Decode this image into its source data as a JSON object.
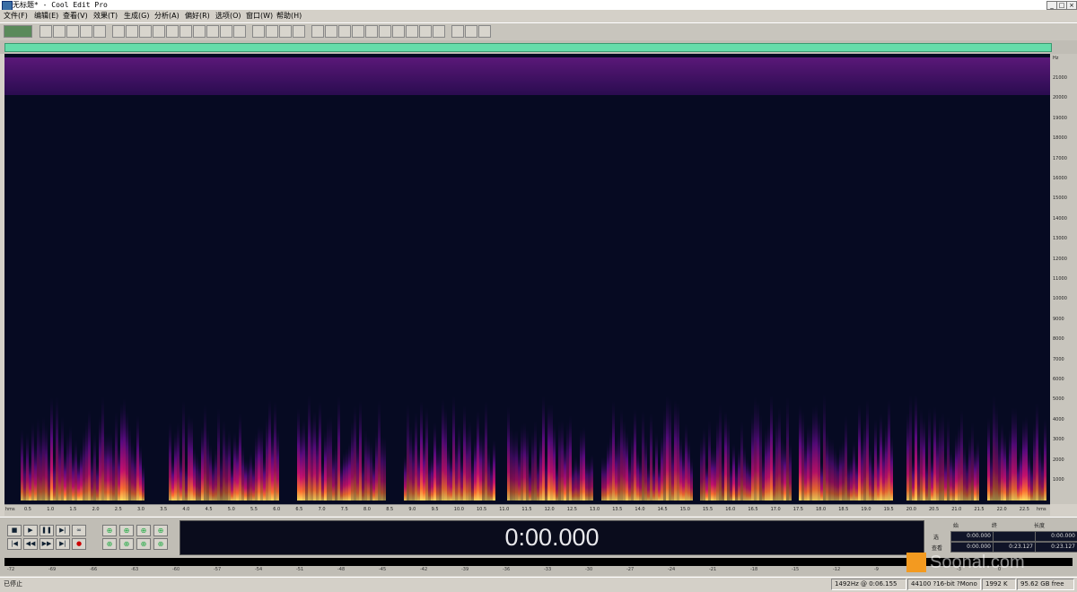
{
  "window": {
    "title": "无标题* - Cool Edit Pro",
    "controls": [
      "_",
      "□",
      "×"
    ]
  },
  "menu": [
    "文件(F)",
    "编辑(E)",
    "查看(V)",
    "效果(T)",
    "生成(G)",
    "分析(A)",
    "偏好(R)",
    "选项(O)",
    "窗口(W)",
    "帮助(H)"
  ],
  "toolbar": {
    "groups": [
      [
        "waveform-view"
      ],
      [
        "new-file-icon",
        "open-file-icon",
        "save-icon",
        "save-as-icon",
        "close-icon"
      ],
      [
        "undo-icon",
        "redo-icon",
        "repeat-icon",
        "copy-icon",
        "paste-icon",
        "cut-icon",
        "mix-paste-icon",
        "crop-icon",
        "trim-icon",
        "select-all-icon"
      ],
      [
        "spectral-view-icon",
        "info-icon",
        "options-icon",
        "settings-icon"
      ],
      [
        "view-1-icon",
        "view-2-icon",
        "view-3-icon",
        "play-icon",
        "view-5-icon",
        "view-6-icon",
        "view-7-icon",
        "view-8-icon",
        "view-9-icon",
        "view-10-icon"
      ],
      [
        "script-icon",
        "batch-icon",
        "help-icon"
      ]
    ]
  },
  "spectrogram": {
    "frequency_unit": "Hz",
    "frequency_ticks": [
      "21000",
      "20000",
      "19000",
      "18000",
      "17000",
      "16000",
      "15000",
      "14000",
      "13000",
      "12000",
      "11000",
      "10000",
      "9000",
      "8000",
      "7000",
      "6000",
      "5000",
      "4000",
      "3000",
      "2000",
      "1000"
    ],
    "time_unit": "hms",
    "time_ticks": [
      "0.5",
      "1.0",
      "1.5",
      "2.0",
      "2.5",
      "3.0",
      "3.5",
      "4.0",
      "4.5",
      "5.0",
      "5.5",
      "6.0",
      "6.5",
      "7.0",
      "7.5",
      "8.0",
      "8.5",
      "9.0",
      "9.5",
      "10.0",
      "10.5",
      "11.0",
      "11.5",
      "12.0",
      "12.5",
      "13.0",
      "13.5",
      "14.0",
      "14.5",
      "15.0",
      "15.5",
      "16.0",
      "16.5",
      "17.0",
      "17.5",
      "18.0",
      "18.5",
      "19.0",
      "19.5",
      "20.0",
      "20.5",
      "21.0",
      "21.5",
      "22.0",
      "22.5"
    ],
    "colors": {
      "background": "#060a22",
      "low": "#3a0a6a",
      "mid": "#c01070",
      "high": "#ffd040"
    }
  },
  "transport": {
    "buttons": [
      "stop",
      "play",
      "pause",
      "play-to-end",
      "loop",
      "go-start",
      "rewind",
      "fast-forward",
      "go-end",
      "record"
    ],
    "zoom_buttons": [
      "zoom-in-h",
      "zoom-out-h",
      "zoom-full",
      "zoom-in-left",
      "zoom-in-right",
      "zoom-in-v",
      "zoom-out-v",
      "zoom-sel"
    ],
    "time_display": "0:00.000"
  },
  "selection": {
    "headers": {
      "begin": "始",
      "end": "终",
      "length": "长度"
    },
    "rows": [
      {
        "label": "选",
        "begin": "0:00.000",
        "end": "",
        "length": "0:00.000"
      },
      {
        "label": "查看",
        "begin": "0:00.000",
        "end": "0:23.127",
        "length": "0:23.127"
      }
    ]
  },
  "meter": {
    "ticks": [
      "-72",
      "-69",
      "-66",
      "-63",
      "-60",
      "-57",
      "-54",
      "-51",
      "-48",
      "-45",
      "-42",
      "-39",
      "-36",
      "-33",
      "-30",
      "-27",
      "-24",
      "-21",
      "-18",
      "-15",
      "-12",
      "-9",
      "-6",
      "-3",
      "0"
    ]
  },
  "status": {
    "message": "已停止",
    "cursor": "1492Hz @ 0:06.155",
    "format": "44100 ?16-bit ?Mono",
    "size": "1992 K",
    "free": "95.62 GB free"
  },
  "watermark": "Soonal.com"
}
